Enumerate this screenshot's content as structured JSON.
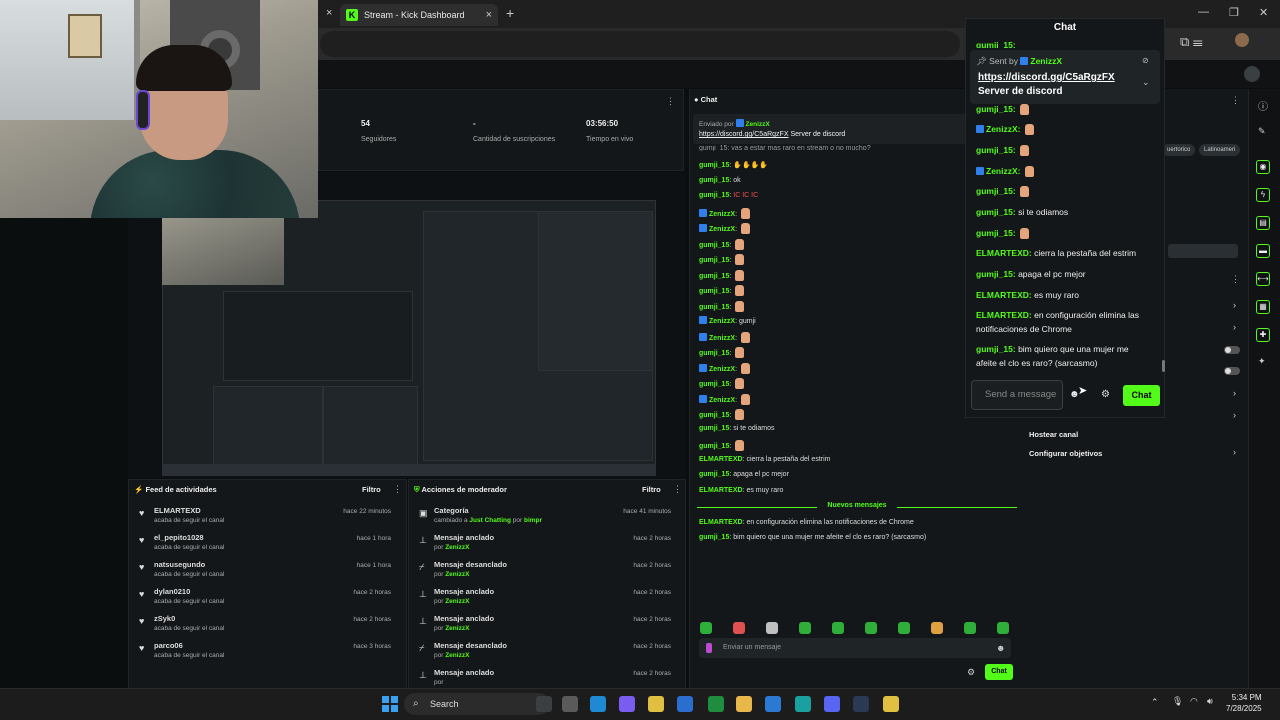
{
  "browser": {
    "tab_title": "Stream - Kick Dashboard",
    "tab_close": "×",
    "prev_tab_close": "×",
    "new_tab": "+",
    "minimize": "—",
    "restore": "❐",
    "close": "✕"
  },
  "stats": [
    {
      "value": "54",
      "label": "Seguidores"
    },
    {
      "value": "-",
      "label": "Cantidad de suscripciones"
    },
    {
      "value": "03:56:50",
      "label": "Tiempo en vivo"
    }
  ],
  "activity_feed": {
    "title": "Feed de actividades",
    "filter": "Filtro",
    "items": [
      {
        "user": "ELMARTEXD",
        "sub": "acaba de seguir el canal",
        "time": "hace 22 minutos"
      },
      {
        "user": "el_pepito1028",
        "sub": "acaba de seguir el canal",
        "time": "hace 1 hora"
      },
      {
        "user": "natsusegundo",
        "sub": "acaba de seguir el canal",
        "time": "hace 1 hora"
      },
      {
        "user": "dylan0210",
        "sub": "acaba de seguir el canal",
        "time": "hace 2 horas"
      },
      {
        "user": "zSyk0",
        "sub": "acaba de seguir el canal",
        "time": "hace 2 horas"
      },
      {
        "user": "parco06",
        "sub": "acaba de seguir el canal",
        "time": "hace 3 horas"
      }
    ]
  },
  "mod_actions": {
    "title": "Acciones de moderador",
    "filter": "Filtro",
    "items": [
      {
        "action": "Categoría",
        "pre": "cambiado a ",
        "target": "Just Chatting",
        "mid": " por ",
        "by": "bimpr",
        "time": "hace 41 minutos"
      },
      {
        "action": "Mensaje anclado",
        "pre": "por ",
        "target": "",
        "mid": "",
        "by": "ZenizzX",
        "time": "hace 2 horas"
      },
      {
        "action": "Mensaje desanclado",
        "pre": "por ",
        "target": "",
        "mid": "",
        "by": "ZenizzX",
        "time": "hace 2 horas"
      },
      {
        "action": "Mensaje anclado",
        "pre": "por ",
        "target": "",
        "mid": "",
        "by": "ZenizzX",
        "time": "hace 2 horas"
      },
      {
        "action": "Mensaje anclado",
        "pre": "por ",
        "target": "",
        "mid": "",
        "by": "ZenizzX",
        "time": "hace 2 horas"
      },
      {
        "action": "Mensaje desanclado",
        "pre": "por ",
        "target": "",
        "mid": "",
        "by": "ZenizzX",
        "time": "hace 2 horas"
      },
      {
        "action": "Mensaje anclado",
        "pre": "por ",
        "target": "",
        "mid": "",
        "by": "",
        "time": "hace 2 horas"
      }
    ]
  },
  "dash_chat": {
    "title": "Chat",
    "pinned_by": "Enviado por",
    "pinned_user": "ZenizzX",
    "pinned_link": "https://discord.gg/C5aRgzFX",
    "pinned_text": " Server de discord",
    "partial_line": "gumji_15: vas a estar mas raro en stream o no mucho?",
    "messages": [
      {
        "user": "gumji_15",
        "text": "",
        "emote": "✋✋✋✋"
      },
      {
        "user": "gumji_15",
        "text": "ok",
        "emote": ""
      },
      {
        "user": "gumji_15",
        "text": "",
        "emote": "IC IC IC"
      },
      {
        "user": "ZenizzX",
        "text": "",
        "emote": "",
        "badge": true,
        "hand": true
      },
      {
        "user": "ZenizzX",
        "text": "",
        "emote": "",
        "badge": true,
        "hand": true
      },
      {
        "user": "gumji_15",
        "text": "",
        "emote": "",
        "hand": true
      },
      {
        "user": "gumji_15",
        "text": "",
        "emote": "",
        "hand": true
      },
      {
        "user": "gumji_15",
        "text": "",
        "emote": "",
        "hand": true
      },
      {
        "user": "gumji_15",
        "text": "",
        "emote": "",
        "hand": true
      },
      {
        "user": "gumji_15",
        "text": "",
        "emote": "",
        "hand": true
      },
      {
        "user": "ZenizzX",
        "text": "gumji",
        "emote": "",
        "badge": true
      },
      {
        "user": "ZenizzX",
        "text": "",
        "emote": "",
        "badge": true,
        "hand": true
      },
      {
        "user": "gumji_15",
        "text": "",
        "emote": "",
        "hand": true
      },
      {
        "user": "ZenizzX",
        "text": "",
        "emote": "",
        "badge": true,
        "hand": true
      },
      {
        "user": "gumji_15",
        "text": "",
        "emote": "",
        "hand": true
      },
      {
        "user": "ZenizzX",
        "text": "",
        "emote": "",
        "badge": true,
        "hand": true
      },
      {
        "user": "gumji_15",
        "text": "",
        "emote": "",
        "hand": true
      },
      {
        "user": "gumji_15",
        "text": "si te odiamos",
        "emote": ""
      },
      {
        "user": "gumji_15",
        "text": "",
        "emote": "",
        "hand": true
      },
      {
        "user": "ELMARTEXD",
        "text": "cierra la pestaña del estrim",
        "emote": ""
      },
      {
        "user": "gumji_15",
        "text": "apaga el pc mejor",
        "emote": ""
      },
      {
        "user": "ELMARTEXD",
        "text": "es muy raro",
        "emote": ""
      }
    ],
    "new_messages": "Nuevos mensajes",
    "new": [
      {
        "user": "ELMARTEXD",
        "text": "en configuración elimina las notificaciones de Chrome"
      },
      {
        "user": "gumji_15",
        "text": "bim quiero que una mujer me afeite el clo es raro? (sarcasmo)"
      }
    ],
    "input_placeholder": "Enviar un mensaje",
    "send": "Chat"
  },
  "right_col": {
    "tags": [
      "Juegos entretenimiento",
      "Latinoamérica"
    ],
    "tag_visible_1": "uertorico",
    "tag_visible_2": "Latinoameri",
    "settings": [
      {
        "label": "Hostear canal"
      },
      {
        "label": "Configurar objetivos"
      }
    ]
  },
  "popout_chat": {
    "title": "Chat",
    "sent_by": "Sent by",
    "sent_user": "ZenizzX",
    "link": "https://discord.gg/C5aRgzFX",
    "link_text": "Server de discord",
    "top_partial": "gumji_15:",
    "messages": [
      {
        "user": "gumji_15",
        "text": "",
        "hand": true
      },
      {
        "user": "ZenizzX",
        "text": "",
        "hand": true,
        "badge": true
      },
      {
        "user": "gumji_15",
        "text": "",
        "hand": true
      },
      {
        "user": "ZenizzX",
        "text": "",
        "hand": true,
        "badge": true
      },
      {
        "user": "gumji_15",
        "text": "",
        "hand": true
      },
      {
        "user": "gumji_15",
        "text": "si te odiamos"
      },
      {
        "user": "gumji_15",
        "text": "",
        "hand": true
      },
      {
        "user": "ELMARTEXD",
        "text": "cierra la pestaña del estrim"
      },
      {
        "user": "gumji_15",
        "text": "apaga el pc mejor"
      },
      {
        "user": "ELMARTEXD",
        "text": "es muy raro"
      }
    ],
    "config_line1": "en configuración elimina las",
    "config_line2": "notificaciones de Chrome",
    "last_line1": "bim quiero que una mujer me",
    "last_line2": "afeite el clo es raro? (sarcasmo)",
    "input_placeholder": "Send a message",
    "send": "Chat"
  },
  "taskbar": {
    "search": "Search",
    "time": "5:34 PM",
    "date": "7/28/2025"
  },
  "colors": {
    "kick_green": "#53fc18",
    "badge_blue": "#2f80ed"
  }
}
